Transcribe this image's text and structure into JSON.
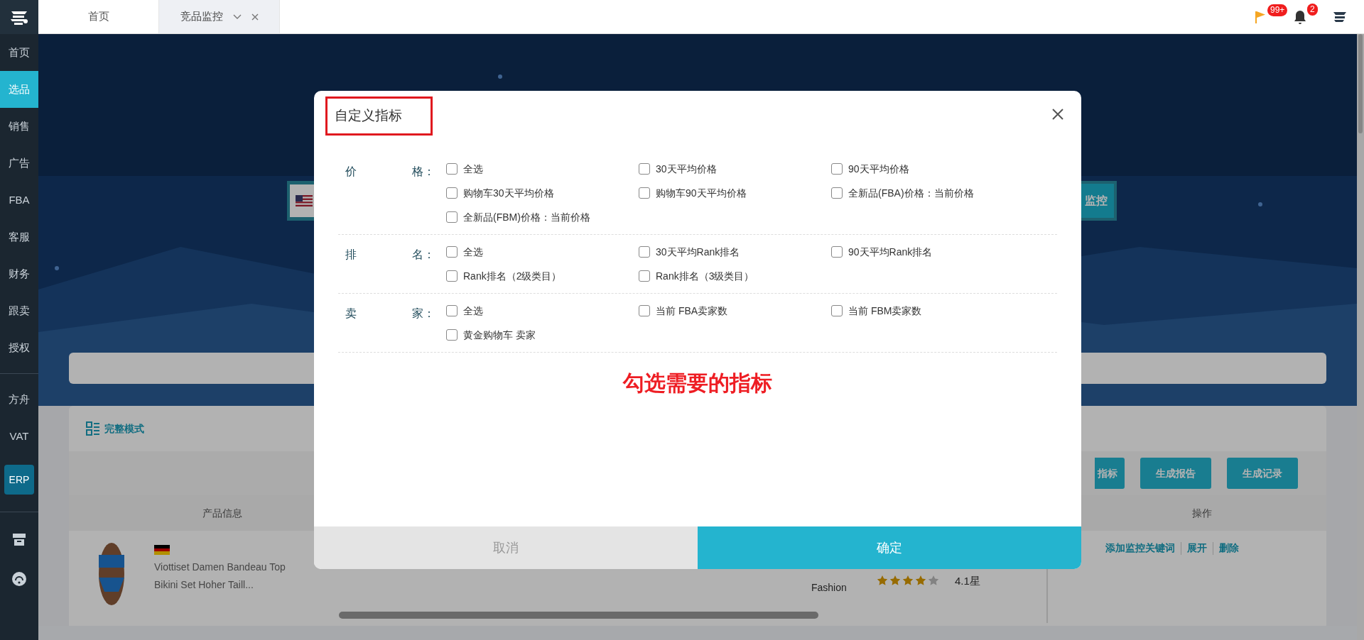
{
  "sidebar": {
    "items": [
      {
        "label": "首页",
        "selected": false,
        "kind": "text"
      },
      {
        "label": "选品",
        "selected": true,
        "kind": "text"
      },
      {
        "label": "销售",
        "selected": false,
        "kind": "text"
      },
      {
        "label": "广告",
        "selected": false,
        "kind": "text"
      },
      {
        "label": "FBA",
        "selected": false,
        "kind": "text"
      },
      {
        "label": "客服",
        "selected": false,
        "kind": "text"
      },
      {
        "label": "财务",
        "selected": false,
        "kind": "text"
      },
      {
        "label": "跟卖",
        "selected": false,
        "kind": "text"
      },
      {
        "label": "授权",
        "selected": false,
        "kind": "text"
      },
      {
        "kind": "divider"
      },
      {
        "label": "方舟",
        "selected": false,
        "kind": "text"
      },
      {
        "label": "VAT",
        "selected": false,
        "kind": "text"
      },
      {
        "label": "ERP",
        "selected": false,
        "kind": "badge"
      },
      {
        "kind": "divider"
      },
      {
        "kind": "store"
      },
      {
        "kind": "support"
      }
    ]
  },
  "tabs": [
    {
      "label": "首页",
      "selected": false,
      "closable": false
    },
    {
      "label": "竞品监控",
      "selected": true,
      "closable": true
    }
  ],
  "header": {
    "flag_badge": "99+",
    "bell_badge": "2"
  },
  "background": {
    "search_button": "监控",
    "mode_label": "完整模式",
    "buttons": [
      "指标",
      "生成报告",
      "生成记录"
    ],
    "columns": [
      "产品信息",
      "操作"
    ],
    "row": {
      "title_lines": [
        "Viottiset Damen Bandeau Top",
        "Bikini Set Hoher Taill..."
      ],
      "category": "Fashion",
      "stars": 4,
      "rating": "4.1星",
      "actions": [
        "添加监控关键词",
        "展开",
        "删除"
      ]
    }
  },
  "modal": {
    "title": "自定义指标",
    "sections": [
      {
        "label": [
          "价",
          "格："
        ],
        "options": [
          {
            "label": "全选",
            "checked": false
          },
          {
            "label": "30天平均价格",
            "checked": false
          },
          {
            "label": "90天平均价格",
            "checked": false
          },
          {
            "label": "购物车30天平均价格",
            "checked": false
          },
          {
            "label": "购物车90天平均价格",
            "checked": false
          },
          {
            "label": "全新品(FBA)价格：当前价格",
            "checked": false
          },
          {
            "label": "全新品(FBM)价格：当前价格",
            "checked": false
          }
        ]
      },
      {
        "label": [
          "排",
          "名："
        ],
        "options": [
          {
            "label": "全选",
            "checked": false
          },
          {
            "label": "30天平均Rank排名",
            "checked": false
          },
          {
            "label": "90天平均Rank排名",
            "checked": false
          },
          {
            "label": "Rank排名（2级类目）",
            "checked": false
          },
          {
            "label": "Rank排名（3级类目）",
            "checked": false
          }
        ]
      },
      {
        "label": [
          "卖",
          "家："
        ],
        "options": [
          {
            "label": "全选",
            "checked": false
          },
          {
            "label": "当前 FBA卖家数",
            "checked": false
          },
          {
            "label": "当前 FBM卖家数",
            "checked": false
          },
          {
            "label": "黄金购物车 卖家",
            "checked": false
          }
        ]
      }
    ],
    "annotation": "勾选需要的指标",
    "cancel": "取消",
    "confirm": "确定"
  }
}
